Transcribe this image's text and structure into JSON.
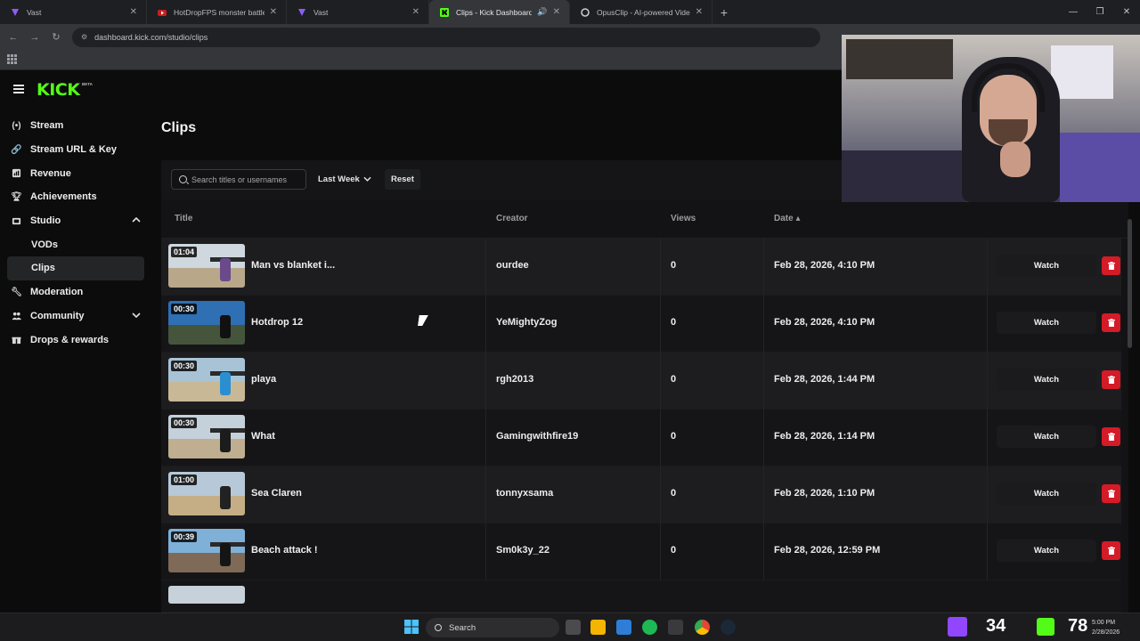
{
  "browser": {
    "tabs": [
      {
        "title": "Vast",
        "active": false,
        "icon": "vast-icon",
        "color": "#8b5cf6"
      },
      {
        "title": "HotDropFPS monster battle sty",
        "active": false,
        "icon": "youtube-icon",
        "color": "#ff2a2a"
      },
      {
        "title": "Vast",
        "active": false,
        "icon": "vast-icon",
        "color": "#8b5cf6"
      },
      {
        "title": "Clips - Kick Dashboard",
        "active": true,
        "icon": "kick-icon",
        "color": "#53fc18"
      },
      {
        "title": "OpusClip - AI-powered Video R",
        "active": false,
        "icon": "opusclip-icon",
        "color": "#cfcfcf"
      }
    ],
    "url": "dashboard.kick.com/studio/clips"
  },
  "brand": {
    "logo": "KICK",
    "badge": "BETA",
    "accent": "#53fc18"
  },
  "sidebar": {
    "items": [
      {
        "label": "Stream",
        "icon": "stream-icon"
      },
      {
        "label": "Stream URL & Key",
        "icon": "link-icon"
      },
      {
        "label": "Revenue",
        "icon": "revenue-icon"
      },
      {
        "label": "Achievements",
        "icon": "trophy-icon"
      },
      {
        "label": "Studio",
        "icon": "studio-icon",
        "expanded": true
      },
      {
        "label": "Moderation",
        "icon": "wrench-icon"
      },
      {
        "label": "Community",
        "icon": "community-icon",
        "expanded": false
      },
      {
        "label": "Drops & rewards",
        "icon": "gift-icon"
      }
    ],
    "studio_sub": [
      {
        "label": "VODs",
        "active": false
      },
      {
        "label": "Clips",
        "active": true
      }
    ]
  },
  "page": {
    "title": "Clips"
  },
  "filters": {
    "search_placeholder": "Search titles or usernames",
    "range": "Last Week",
    "reset": "Reset"
  },
  "table": {
    "headers": {
      "title": "Title",
      "creator": "Creator",
      "views": "Views",
      "date": "Date"
    },
    "watch_label": "Watch",
    "rows": [
      {
        "duration": "01:04",
        "title": "Man vs blanket i...",
        "creator": "ourdee",
        "views": "0",
        "date": "Feb 28, 2026, 4:10 PM"
      },
      {
        "duration": "00:30",
        "title": "Hotdrop 12",
        "creator": "YeMightyZog",
        "views": "0",
        "date": "Feb 28, 2026, 4:10 PM"
      },
      {
        "duration": "00:30",
        "title": "playa",
        "creator": "rgh2013",
        "views": "0",
        "date": "Feb 28, 2026, 1:44 PM"
      },
      {
        "duration": "00:30",
        "title": "What",
        "creator": "Gamingwithfire19",
        "views": "0",
        "date": "Feb 28, 2026, 1:14 PM"
      },
      {
        "duration": "01:00",
        "title": "Sea Claren",
        "creator": "tonnyxsama",
        "views": "0",
        "date": "Feb 28, 2026, 1:10 PM"
      },
      {
        "duration": "00:39",
        "title": "Beach attack !",
        "creator": "Sm0k3y_22",
        "views": "0",
        "date": "Feb 28, 2026, 12:59 PM"
      }
    ]
  },
  "taskbar": {
    "search": "Search",
    "count_a": "34",
    "count_b": "78",
    "clock_time": "5:00 PM",
    "clock_date": "2/28/2026"
  },
  "colors": {
    "delete": "#d41b27",
    "support": "#22b14c"
  }
}
